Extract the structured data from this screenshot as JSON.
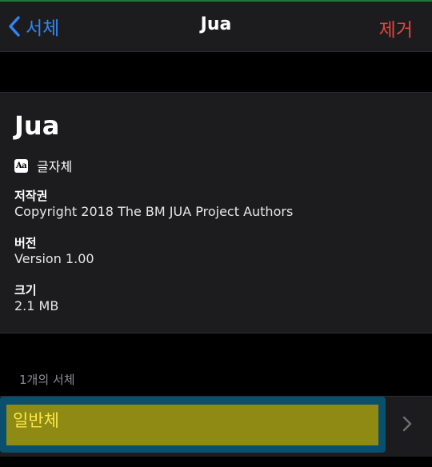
{
  "nav": {
    "back_label": "서체",
    "title": "Jua",
    "remove_label": "제거"
  },
  "font_info": {
    "name": "Jua",
    "type_icon_text": "Aa",
    "type_label": "글자체",
    "copyright_label": "저작권",
    "copyright_value": "Copyright 2018 The BM JUA Project Authors",
    "version_label": "버전",
    "version_value": "Version 1.00",
    "size_label": "크기",
    "size_value": "2.1 MB"
  },
  "styles_section": {
    "header": "1개의 서체",
    "items": [
      {
        "label": "일반체"
      }
    ]
  },
  "colors": {
    "accent_blue": "#2f86f6",
    "destructive_red": "#e5463c",
    "highlight_yellow": "#8e8a13",
    "highlight_border": "#0b4f6e"
  },
  "icons": {
    "back": "chevron-left-icon",
    "type": "font-aa-icon",
    "disclosure": "chevron-right-icon"
  }
}
